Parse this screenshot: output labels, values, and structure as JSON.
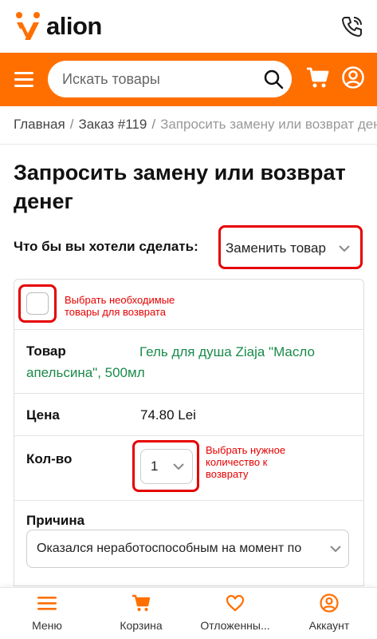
{
  "header": {
    "logo_text": "alion",
    "search_placeholder": "Искать товары"
  },
  "colors": {
    "brand": "#ff6f00",
    "highlight": "#e60000",
    "product": "#1a8a4a"
  },
  "icons": [
    "logo-icon",
    "phone-icon",
    "menu-icon",
    "search-icon",
    "cart-icon",
    "user-icon",
    "heart-icon",
    "chevron-down-icon"
  ],
  "breadcrumb": {
    "home": "Главная",
    "order": "Заказ #119",
    "current": "Запросить замену или возврат денег",
    "sep": "/"
  },
  "page": {
    "title": "Запросить замену или возврат денег",
    "action_label": "Что бы вы хотели сделать:",
    "action_value": "Заменить товар"
  },
  "annotations": {
    "select_items": "Выбрать необходимые товары для возврата",
    "select_qty": "Выбрать нужное количество к возврату"
  },
  "item": {
    "product_label": "Товар",
    "product_name": "Гель для душа Ziaja \"Масло апельсина\", 500мл",
    "price_label": "Цена",
    "price_value": "74.80 Lei",
    "qty_label": "Кол-во",
    "qty_value": "1",
    "reason_label": "Причина",
    "reason_value": "Оказался неработоспособным на момент по"
  },
  "bottom_nav": {
    "menu": "Меню",
    "cart": "Корзина",
    "wishlist": "Отложенны...",
    "account": "Аккаунт"
  }
}
